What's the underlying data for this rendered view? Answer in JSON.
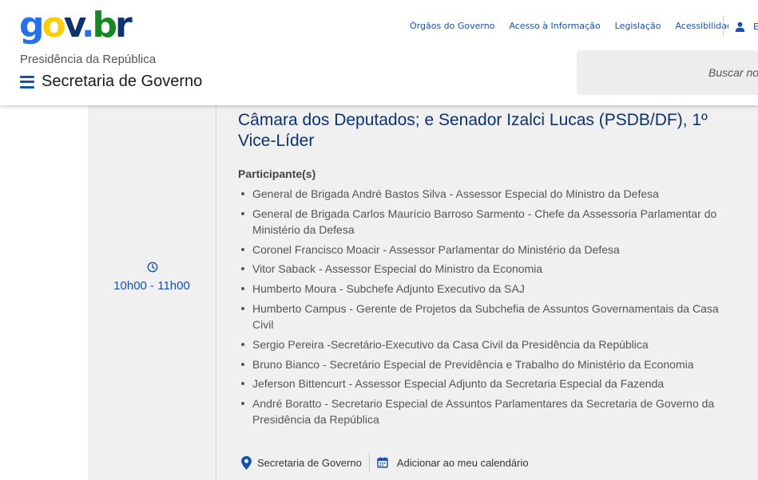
{
  "header": {
    "logo": {
      "g": "g",
      "o": "o",
      "v": "v",
      "dot": ".",
      "b": "b",
      "r": "r"
    },
    "top_links": [
      "Órgãos do Governo",
      "Acesso à Informação",
      "Legislação",
      "Acessibilidade"
    ],
    "login_label": "E",
    "org_name": "Presidência da República",
    "site_title": "Secretaria de Governo",
    "search_placeholder": "Buscar no portal"
  },
  "event": {
    "title": "Câmara dos Deputados; e Senador Izalci Lucas (PSDB/DF), 1º Vice-Líder",
    "time": "10h00 - 11h00",
    "participants_label": "Participante(s)",
    "participants": [
      "General de Brigada André Bastos Silva - Assessor Especial do Ministro da Defesa",
      "General de Brigada Carlos Maurício Barroso Sarmento - Chefe da Assessoria Parlamentar do Ministério da Defesa",
      "Coronel Francisco Moacir - Assessor Parlamentar do Ministério da Defesa",
      "Vitor Saback - Assessor Especial do Ministro da Economia",
      "Humberto Moura - Subchefe Adjunto Executivo da SAJ",
      "Humberto Campus - Gerente de Projetos da Subchefia de Assuntos Governamentais da Casa Civil",
      "Sergio Pereira -Secretário-Executivo da Casa Civil da Presidência da República",
      "Bruno Bianco - Secretário Especial de Previdência e Trabalho do Ministério da Economia",
      "Jeferson Bittencurt - Assessor Especial Adjunto da Secretaria Especial da Fazenda",
      "André Boratto - Secretario Especial de Assuntos Parlamentares da Secretaria de Governo da Presidência da República"
    ],
    "location": "Secretaria de Governo",
    "add_calendar": "Adicionar ao meu calendário"
  },
  "colors": {
    "primary": "#1351b4",
    "title": "#0c326f",
    "panel_bg": "#f0f0f0"
  },
  "icons": [
    "menu-icon",
    "user-icon",
    "clock-icon",
    "location-pin-icon",
    "calendar-icon"
  ]
}
